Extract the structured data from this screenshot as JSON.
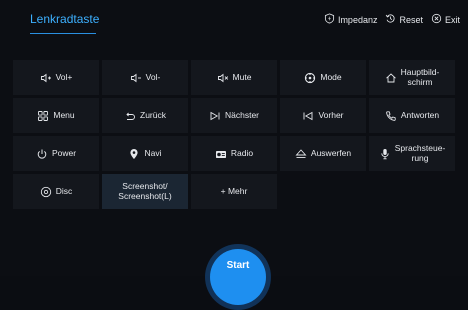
{
  "header": {
    "tab_label": "Lenkradtaste",
    "actions": {
      "impedance": "Impedanz",
      "reset": "Reset",
      "exit": "Exit"
    }
  },
  "buttons": {
    "vol_up": "Vol+",
    "vol_down": "Vol-",
    "mute": "Mute",
    "mode": "Mode",
    "home": "Hauptbild-\nschirm",
    "menu": "Menu",
    "back": "Zurück",
    "next": "Nächster",
    "prev": "Vorher",
    "answer": "Antworten",
    "power": "Power",
    "navi": "Navi",
    "radio": "Radio",
    "eject": "Auswerfen",
    "voice": "Sprachsteue-\nrung",
    "disc": "Disc",
    "screenshot": "Screenshot/\nScreenshot(L)",
    "more": "+ Mehr"
  },
  "start_label": "Start",
  "colors": {
    "accent": "#3db0ff",
    "start": "#1e8ff0",
    "button_bg": "#14171d",
    "background": "#0c0e13"
  }
}
